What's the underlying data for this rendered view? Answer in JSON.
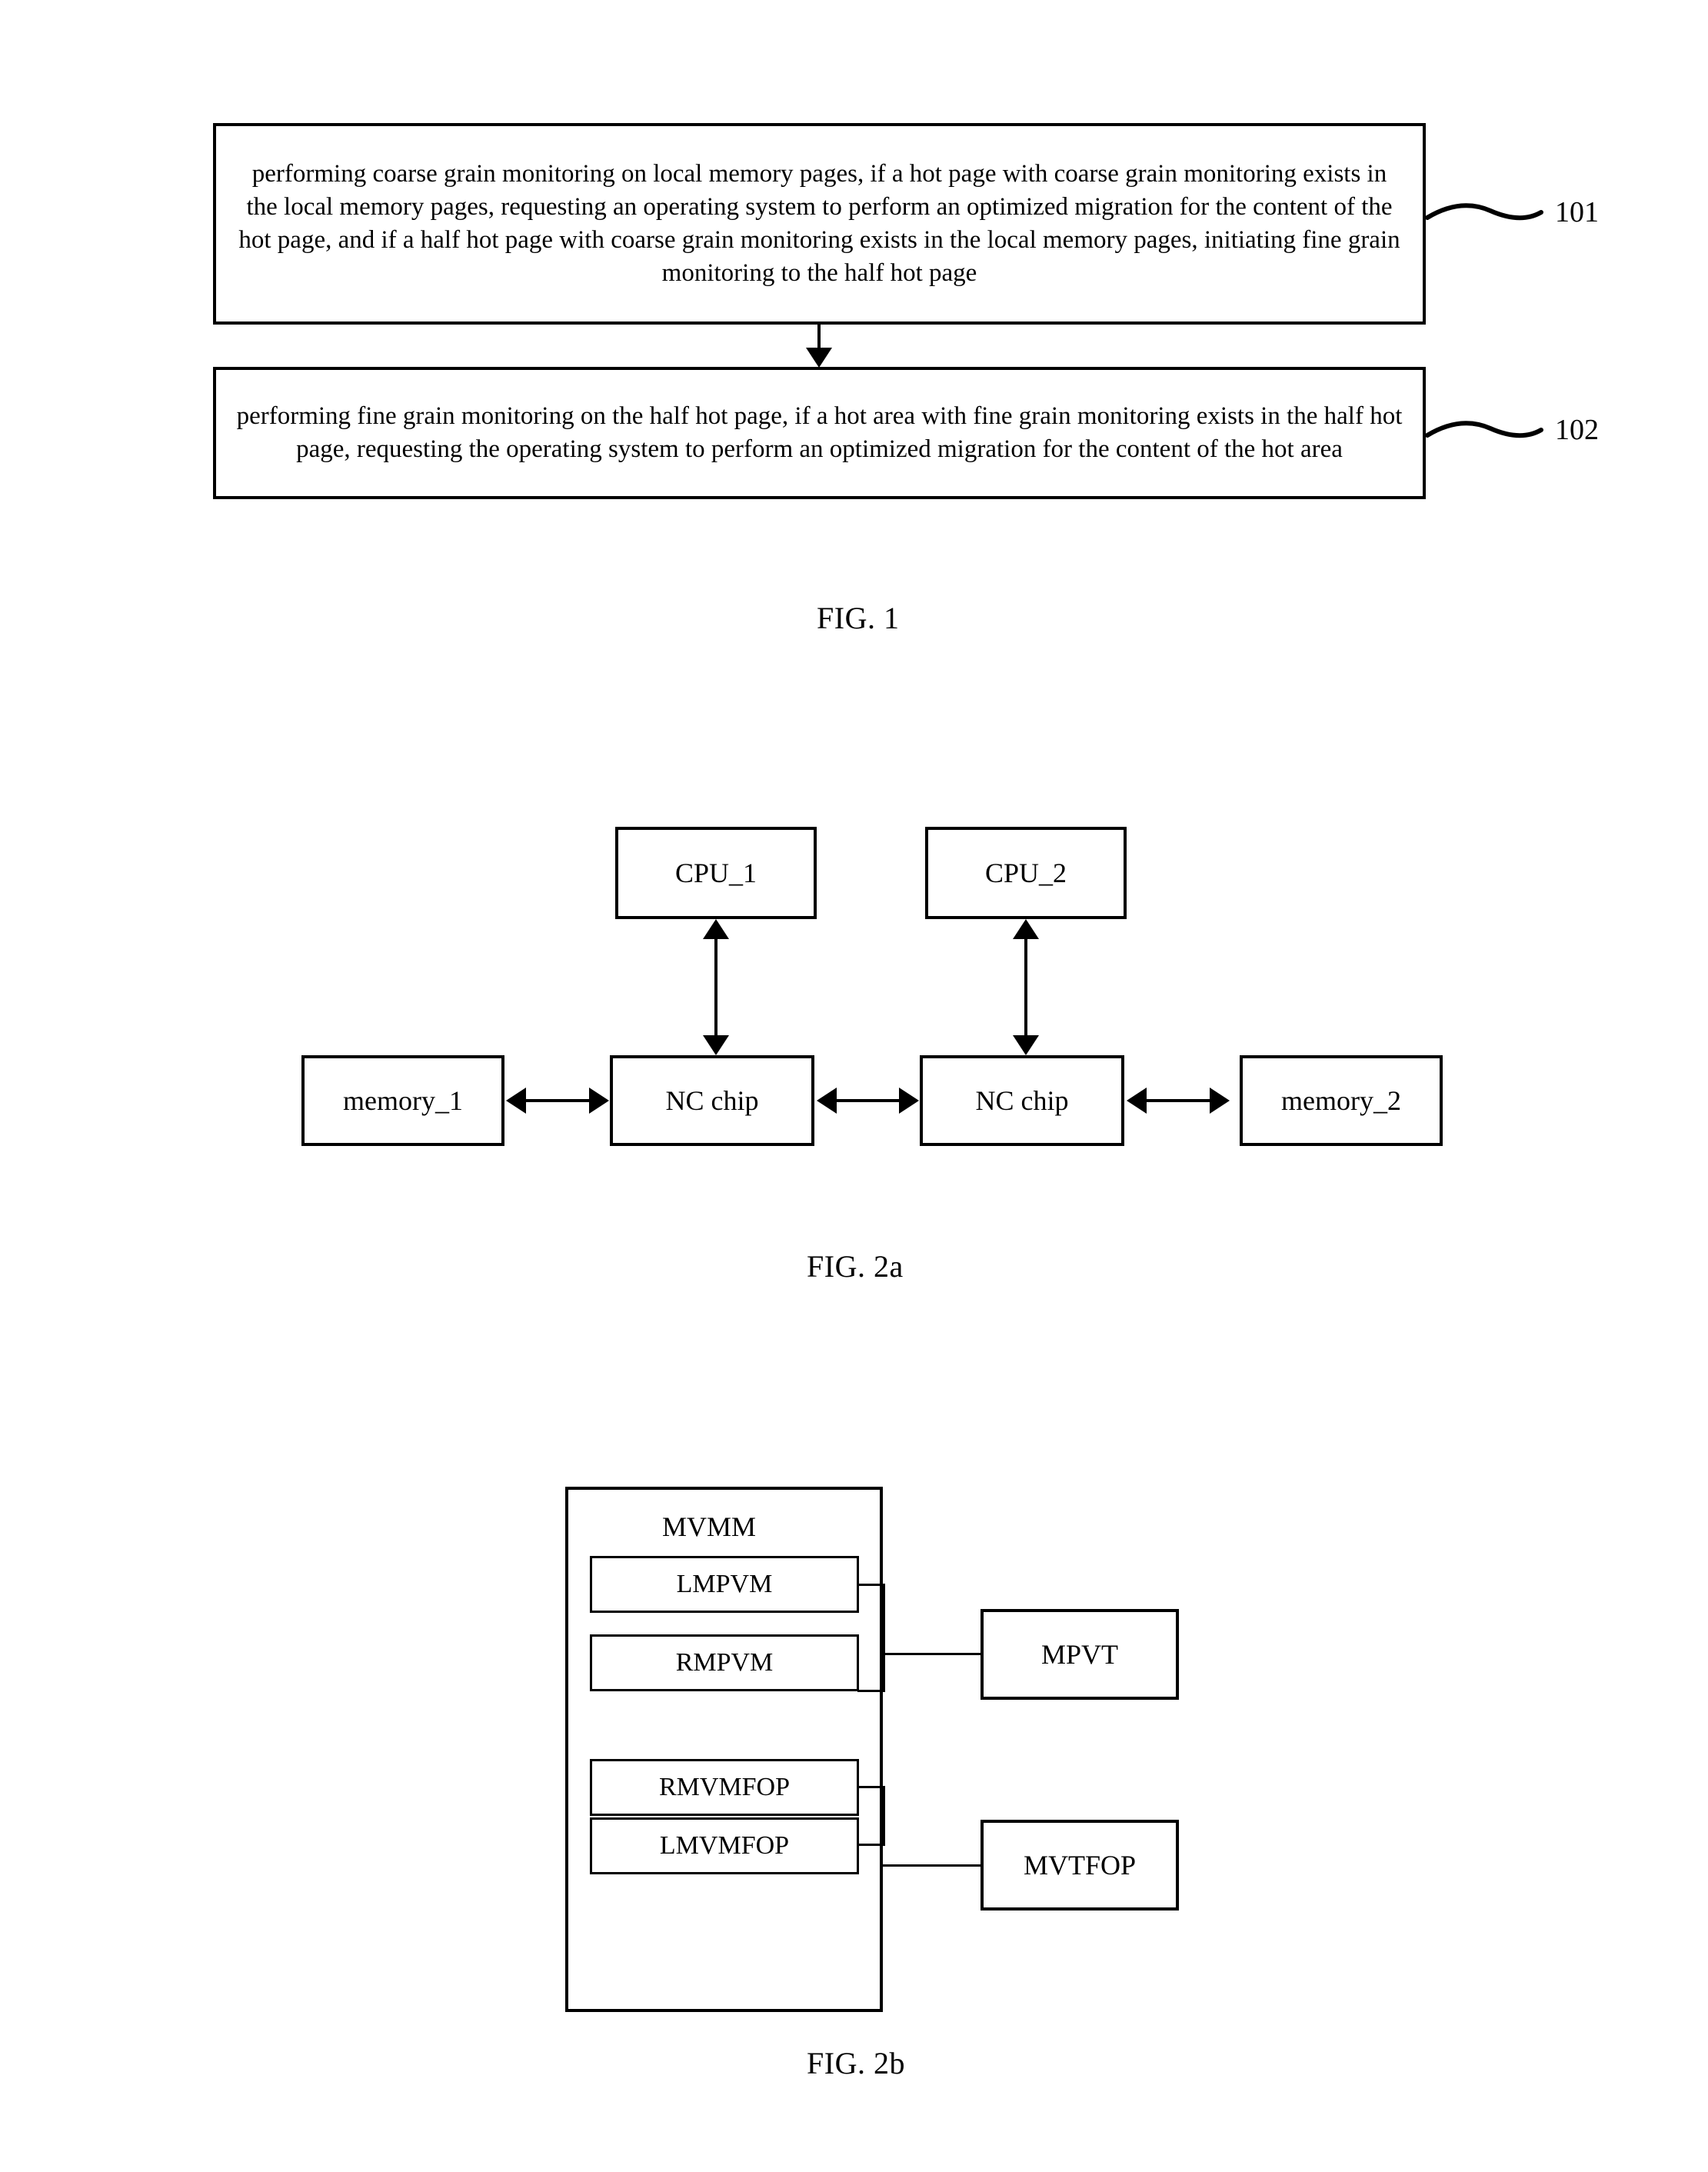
{
  "document": {
    "type": "patent-figure-sheet"
  },
  "fig1": {
    "caption": "FIG. 1",
    "steps": [
      {
        "id": "step-101",
        "text": "performing coarse grain monitoring on local memory pages, if a hot page with coarse grain monitoring exists in the local memory pages, requesting an operating system to perform an optimized migration for the content of the hot page, and if a half hot page with coarse grain monitoring exists in the local memory pages, initiating fine grain monitoring to the half hot page",
        "ref": "101"
      },
      {
        "id": "step-102",
        "text": "performing fine grain monitoring on the half hot page, if a hot area with fine grain monitoring exists in the half hot page, requesting the operating system to perform an optimized migration for the content of the hot area",
        "ref": "102"
      }
    ]
  },
  "fig2a": {
    "caption": "FIG. 2a",
    "nodes": {
      "cpu1": "CPU_1",
      "cpu2": "CPU_2",
      "memory1": "memory_1",
      "memory2": "memory_2",
      "nc_chip_left": "NC chip",
      "nc_chip_right": "NC chip"
    }
  },
  "fig2b": {
    "caption": "FIG. 2b",
    "container": "MVMM",
    "modules": [
      "LMPVM",
      "RMPVM",
      "RMVMFOP",
      "LMVMFOP"
    ],
    "external": [
      "MPVT",
      "MVTFOP"
    ]
  },
  "colors": {
    "ink": "#000000",
    "paper": "#ffffff"
  }
}
